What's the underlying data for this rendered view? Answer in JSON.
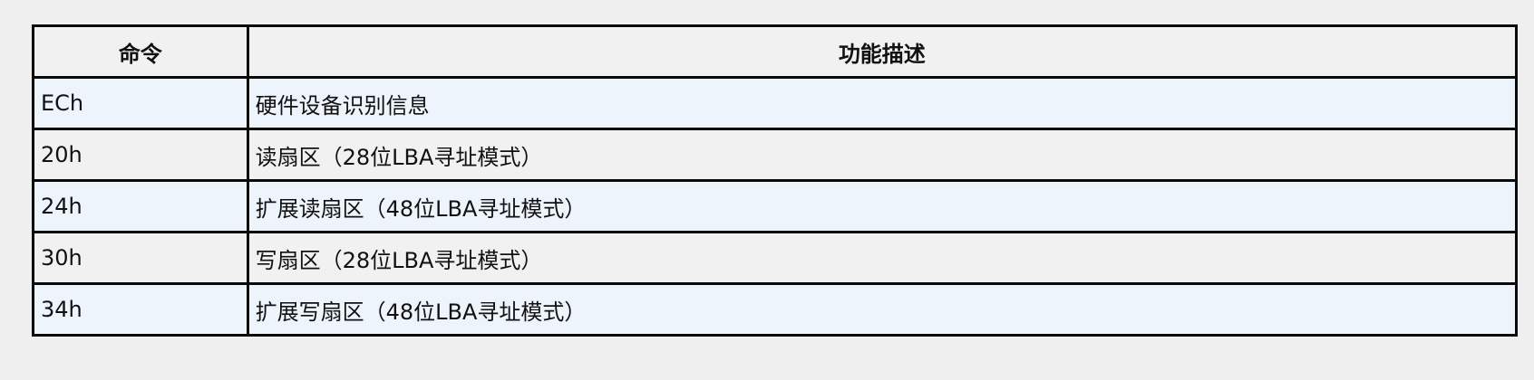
{
  "table": {
    "headers": [
      "命令",
      "功能描述"
    ],
    "rows": [
      {
        "cmd": "ECh",
        "desc": "硬件设备识别信息"
      },
      {
        "cmd": "20h",
        "desc": "读扇区（28位LBA寻址模式）"
      },
      {
        "cmd": "24h",
        "desc": "扩展读扇区（48位LBA寻址模式）"
      },
      {
        "cmd": "30h",
        "desc": "写扇区（28位LBA寻址模式）"
      },
      {
        "cmd": "34h",
        "desc": "扩展写扇区（48位LBA寻址模式）"
      }
    ]
  }
}
